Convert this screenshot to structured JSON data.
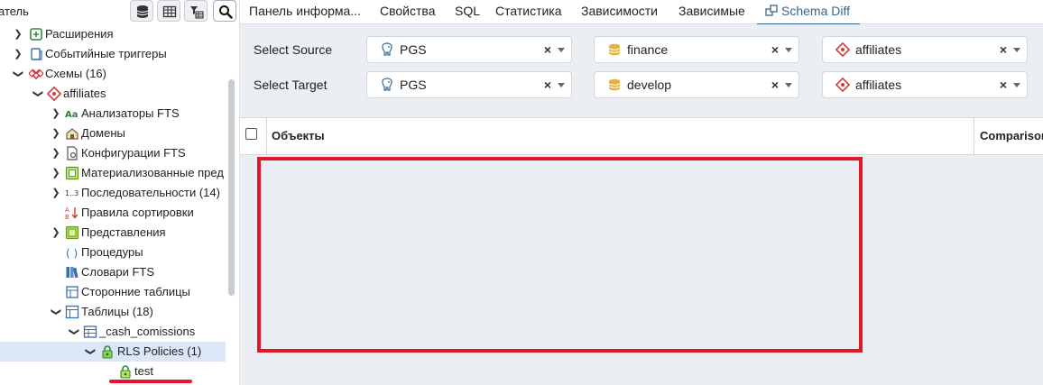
{
  "browser": {
    "title": "атель",
    "toolbar_icons": [
      "database-icon",
      "grid-icon",
      "filter-table-icon",
      "search-icon"
    ],
    "tree": [
      {
        "label": "Расширения",
        "icon": "extension-icon",
        "expanded": false
      },
      {
        "label": "Событийные триггеры",
        "icon": "event-trigger-icon",
        "expanded": false
      },
      {
        "label": "Схемы (16)",
        "icon": "schemas-icon",
        "expanded": true
      },
      {
        "label": "affiliates",
        "icon": "schema-icon",
        "expanded": true
      },
      {
        "label": "Анализаторы FTS",
        "icon": "fts-parser-icon",
        "expanded": false
      },
      {
        "label": "Домены",
        "icon": "domain-icon",
        "expanded": false
      },
      {
        "label": "Конфигурации FTS",
        "icon": "fts-config-icon",
        "expanded": false
      },
      {
        "label": "Материализованные пред",
        "icon": "materialized-view-icon",
        "expanded": false
      },
      {
        "label": "Последовательности (14)",
        "icon": "sequence-icon",
        "expanded": false
      },
      {
        "label": "Правила сортировки",
        "icon": "collation-icon",
        "expanded": null
      },
      {
        "label": "Представления",
        "icon": "view-icon",
        "expanded": false
      },
      {
        "label": "Процедуры",
        "icon": "procedure-icon",
        "expanded": null
      },
      {
        "label": "Словари FTS",
        "icon": "fts-dictionary-icon",
        "expanded": null
      },
      {
        "label": "Сторонние таблицы",
        "icon": "foreign-table-icon",
        "expanded": null
      },
      {
        "label": "Таблицы (18)",
        "icon": "tables-icon",
        "expanded": true
      },
      {
        "label": "_cash_comissions",
        "icon": "table-icon",
        "expanded": true
      },
      {
        "label": "RLS Policies (1)",
        "icon": "rls-policies-icon",
        "expanded": true,
        "selected": true
      },
      {
        "label": "test",
        "icon": "rls-policy-icon",
        "expanded": null
      }
    ]
  },
  "tabs": [
    {
      "label": "Панель информа..."
    },
    {
      "label": "Свойства"
    },
    {
      "label": "SQL"
    },
    {
      "label": "Статистика"
    },
    {
      "label": "Зависимости"
    },
    {
      "label": "Зависимые"
    },
    {
      "label": "Schema Diff",
      "active": true,
      "icon": "schema-diff-icon"
    }
  ],
  "schema_diff": {
    "source": {
      "label": "Select Source",
      "server": {
        "value": "PGS",
        "icon": "postgres-elephant-icon"
      },
      "database": {
        "value": "finance",
        "icon": "database-icon"
      },
      "schema": {
        "value": "affiliates",
        "icon": "schema-icon"
      }
    },
    "target": {
      "label": "Select Target",
      "server": {
        "value": "PGS",
        "icon": "postgres-elephant-icon"
      },
      "database": {
        "value": "develop",
        "icon": "database-icon"
      },
      "schema": {
        "value": "affiliates",
        "icon": "schema-icon"
      }
    },
    "clear_glyph": "×",
    "grid": {
      "columns": [
        "Объекты",
        "Comparison"
      ]
    }
  },
  "colors": {
    "accent": "#326690",
    "highlight": "#e3172b",
    "panel_bg": "#ebeef3",
    "selected_row": "#dbe6f6"
  }
}
